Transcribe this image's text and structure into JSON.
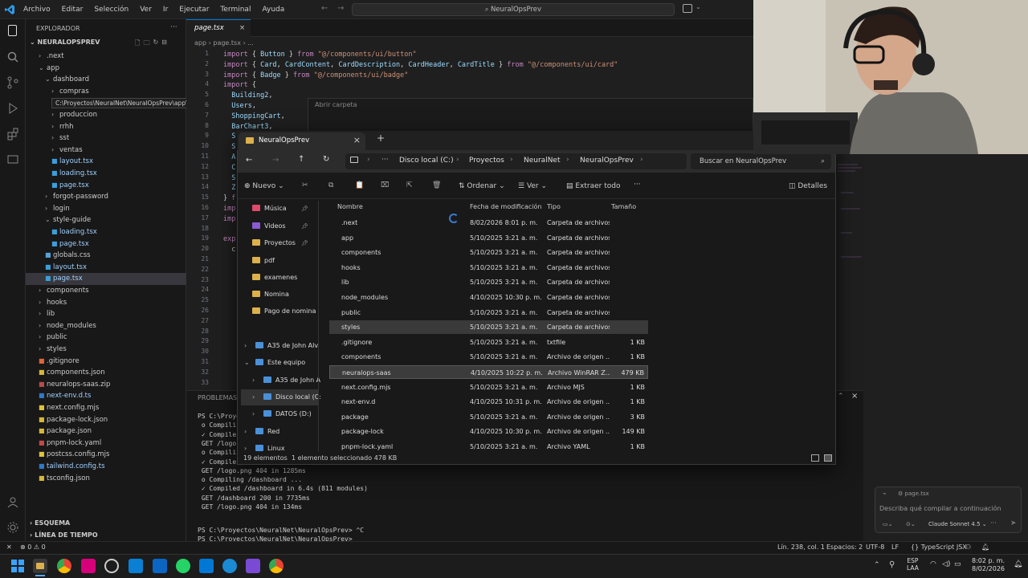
{
  "menu": [
    "Archivo",
    "Editar",
    "Selección",
    "Ver",
    "Ir",
    "Ejecutar",
    "Terminal",
    "Ayuda"
  ],
  "command_center": "NeuralOpsPrev",
  "explorer": {
    "header": "EXPLORADOR",
    "root": "NEURALOPSPREV",
    "tooltip": "C:\\Proyectos\\NeuralNet\\NeuralOpsPrev\\app\\dashboard\\compras",
    "items": [
      {
        "label": ".next",
        "indent": 1,
        "kind": "folder",
        "open": false
      },
      {
        "label": "app",
        "indent": 1,
        "kind": "folder",
        "open": true
      },
      {
        "label": "dashboard",
        "indent": 2,
        "kind": "folder",
        "open": true
      },
      {
        "label": "compras",
        "indent": 3,
        "kind": "folder",
        "open": false
      },
      {
        "label": "",
        "indent": 3,
        "kind": "hidden",
        "open": false
      },
      {
        "label": "produccion",
        "indent": 3,
        "kind": "folder",
        "open": false
      },
      {
        "label": "rrhh",
        "indent": 3,
        "kind": "folder",
        "open": false
      },
      {
        "label": "sst",
        "indent": 3,
        "kind": "folder",
        "open": false
      },
      {
        "label": "ventas",
        "indent": 3,
        "kind": "folder",
        "open": false
      },
      {
        "label": "layout.tsx",
        "indent": 3,
        "kind": "tsx",
        "open": false
      },
      {
        "label": "loading.tsx",
        "indent": 3,
        "kind": "tsx",
        "open": false
      },
      {
        "label": "page.tsx",
        "indent": 3,
        "kind": "tsx",
        "open": false
      },
      {
        "label": "forgot-password",
        "indent": 2,
        "kind": "folder",
        "open": false
      },
      {
        "label": "login",
        "indent": 2,
        "kind": "folder",
        "open": false
      },
      {
        "label": "style-guide",
        "indent": 2,
        "kind": "folder",
        "open": true
      },
      {
        "label": "loading.tsx",
        "indent": 3,
        "kind": "tsx",
        "open": false
      },
      {
        "label": "page.tsx",
        "indent": 3,
        "kind": "tsx",
        "open": false
      },
      {
        "label": "globals.css",
        "indent": 2,
        "kind": "css",
        "open": false
      },
      {
        "label": "layout.tsx",
        "indent": 2,
        "kind": "tsx",
        "open": false
      },
      {
        "label": "page.tsx",
        "indent": 2,
        "kind": "tsx",
        "open": false
      },
      {
        "label": "components",
        "indent": 1,
        "kind": "folder",
        "open": false
      },
      {
        "label": "hooks",
        "indent": 1,
        "kind": "folder",
        "open": false
      },
      {
        "label": "lib",
        "indent": 1,
        "kind": "folder",
        "open": false
      },
      {
        "label": "node_modules",
        "indent": 1,
        "kind": "folder",
        "open": false
      },
      {
        "label": "public",
        "indent": 1,
        "kind": "folder",
        "open": false
      },
      {
        "label": "styles",
        "indent": 1,
        "kind": "folder",
        "open": false
      },
      {
        "label": ".gitignore",
        "indent": 1,
        "kind": "git",
        "open": false
      },
      {
        "label": "components.json",
        "indent": 1,
        "kind": "json",
        "open": false
      },
      {
        "label": "neuralops-saas.zip",
        "indent": 1,
        "kind": "zip",
        "open": false
      },
      {
        "label": "next-env.d.ts",
        "indent": 1,
        "kind": "ts",
        "open": false
      },
      {
        "label": "next.config.mjs",
        "indent": 1,
        "kind": "js",
        "open": false
      },
      {
        "label": "package-lock.json",
        "indent": 1,
        "kind": "json",
        "open": false
      },
      {
        "label": "package.json",
        "indent": 1,
        "kind": "json",
        "open": false
      },
      {
        "label": "pnpm-lock.yaml",
        "indent": 1,
        "kind": "yaml",
        "open": false
      },
      {
        "label": "postcss.config.mjs",
        "indent": 1,
        "kind": "js",
        "open": false
      },
      {
        "label": "tailwind.config.ts",
        "indent": 1,
        "kind": "ts",
        "open": false
      },
      {
        "label": "tsconfig.json",
        "indent": 1,
        "kind": "json",
        "open": false
      }
    ],
    "outline": "ESQUEMA",
    "timeline": "LÍNEA DE TIEMPO"
  },
  "editor": {
    "tab": "page.tsx",
    "breadcrumb": [
      "app",
      "page.tsx",
      "..."
    ],
    "lines": [
      {
        "n": "1",
        "t": [
          [
            "kw",
            "import "
          ],
          [
            "pl",
            "{ "
          ],
          [
            "id",
            "Button"
          ],
          [
            "pl",
            " } "
          ],
          [
            "kw",
            "from "
          ],
          [
            "str",
            "\"@/components/ui/button\""
          ]
        ]
      },
      {
        "n": "2",
        "t": [
          [
            "kw",
            "import "
          ],
          [
            "pl",
            "{ "
          ],
          [
            "id",
            "Card"
          ],
          [
            "pl",
            ", "
          ],
          [
            "id",
            "CardContent"
          ],
          [
            "pl",
            ", "
          ],
          [
            "id",
            "CardDescription"
          ],
          [
            "pl",
            ", "
          ],
          [
            "id",
            "CardHeader"
          ],
          [
            "pl",
            ", "
          ],
          [
            "id",
            "CardTitle"
          ],
          [
            "pl",
            " } "
          ],
          [
            "kw",
            "from "
          ],
          [
            "str",
            "\"@/components/ui/card\""
          ]
        ]
      },
      {
        "n": "3",
        "t": [
          [
            "kw",
            "import "
          ],
          [
            "pl",
            "{ "
          ],
          [
            "id",
            "Badge"
          ],
          [
            "pl",
            " } "
          ],
          [
            "kw",
            "from "
          ],
          [
            "str",
            "\"@/components/ui/badge\""
          ]
        ]
      },
      {
        "n": "4",
        "t": [
          [
            "kw",
            "import "
          ],
          [
            "pl",
            "{"
          ]
        ]
      },
      {
        "n": "5",
        "t": [
          [
            "pl",
            "  "
          ],
          [
            "id",
            "Building2"
          ],
          [
            "pl",
            ","
          ]
        ]
      },
      {
        "n": "6",
        "t": [
          [
            "pl",
            "  "
          ],
          [
            "id",
            "Users"
          ],
          [
            "pl",
            ","
          ]
        ]
      },
      {
        "n": "7",
        "t": [
          [
            "pl",
            "  "
          ],
          [
            "id",
            "ShoppingCart"
          ],
          [
            "pl",
            ","
          ]
        ]
      },
      {
        "n": "8",
        "t": [
          [
            "pl",
            "  "
          ],
          [
            "id",
            "BarChart3"
          ],
          [
            "pl",
            ","
          ]
        ]
      },
      {
        "n": "9",
        "t": [
          [
            "pl",
            "  "
          ],
          [
            "id",
            "S"
          ]
        ]
      },
      {
        "n": "10",
        "t": [
          [
            "pl",
            "  "
          ],
          [
            "id",
            "S"
          ]
        ]
      },
      {
        "n": "11",
        "t": [
          [
            "pl",
            "  "
          ],
          [
            "id",
            "A"
          ]
        ]
      },
      {
        "n": "12",
        "t": [
          [
            "pl",
            "  "
          ],
          [
            "id",
            "C"
          ]
        ]
      },
      {
        "n": "13",
        "t": [
          [
            "pl",
            "  "
          ],
          [
            "id",
            "S"
          ]
        ]
      },
      {
        "n": "14",
        "t": [
          [
            "pl",
            "  "
          ],
          [
            "id",
            "Z"
          ]
        ]
      },
      {
        "n": "15",
        "t": [
          [
            "pl",
            "} "
          ],
          [
            "kw",
            "f"
          ]
        ]
      },
      {
        "n": "16",
        "t": [
          [
            "kw",
            "imp"
          ]
        ]
      },
      {
        "n": "17",
        "t": [
          [
            "kw",
            "imp"
          ]
        ]
      },
      {
        "n": "18",
        "t": [
          [
            "pl",
            ""
          ]
        ]
      },
      {
        "n": "19",
        "t": [
          [
            "kw",
            "exp"
          ]
        ]
      },
      {
        "n": "20",
        "t": [
          [
            "pl",
            "  c"
          ]
        ]
      },
      {
        "n": "21",
        "t": [
          [
            "pl",
            ""
          ]
        ]
      },
      {
        "n": "22",
        "t": [
          [
            "pl",
            ""
          ]
        ]
      },
      {
        "n": "23",
        "t": [
          [
            "pl",
            ""
          ]
        ]
      },
      {
        "n": "24",
        "t": [
          [
            "pl",
            ""
          ]
        ]
      },
      {
        "n": "25",
        "t": [
          [
            "pl",
            ""
          ]
        ]
      },
      {
        "n": "26",
        "t": [
          [
            "pl",
            ""
          ]
        ]
      },
      {
        "n": "27",
        "t": [
          [
            "pl",
            ""
          ]
        ]
      },
      {
        "n": "28",
        "t": [
          [
            "pl",
            ""
          ]
        ]
      },
      {
        "n": "29",
        "t": [
          [
            "pl",
            ""
          ]
        ]
      },
      {
        "n": "30",
        "t": [
          [
            "pl",
            ""
          ]
        ]
      },
      {
        "n": "31",
        "t": [
          [
            "pl",
            ""
          ]
        ]
      },
      {
        "n": "32",
        "t": [
          [
            "pl",
            ""
          ]
        ]
      },
      {
        "n": "33",
        "t": [
          [
            "pl",
            ""
          ]
        ]
      }
    ],
    "dialog_hint": "Abrir carpeta"
  },
  "terminal": {
    "tab": "PROBLEMAS",
    "lines": [
      "PS C:\\Proyec",
      " o Compili",
      " ✓ Compile",
      " GET /logo",
      " o Compili",
      " ✓ Compile",
      " GET /logo.png 404 in 1285ms",
      " o Compiling /dashboard ...",
      " ✓ Compiled /dashboard in 6.4s (811 modules)",
      " GET /dashboard 200 in 7735ms",
      " GET /logo.png 404 in 134ms",
      "",
      "PS C:\\Proyectos\\NeuralNet\\NeuralOpsPrev> ^C",
      "PS C:\\Proyectos\\NeuralNet\\NeuralOpsPrev> "
    ]
  },
  "status": {
    "errors": "⊗ 0  ⚠ 0",
    "position": "Lín. 238, col. 1",
    "spaces": "Espacios: 2",
    "encoding": "UTF-8",
    "eol": "LF",
    "language": "{} TypeScript JSX"
  },
  "chat": {
    "file": "page.tsx",
    "placeholder": "Describa qué compilar a continuación",
    "model": "Claude Sonnet 4.5"
  },
  "explorer_window": {
    "tab_title": "NeuralOpsPrev",
    "breadcrumb": [
      "Disco local (C:)",
      "Proyectos",
      "NeuralNet",
      "NeuralOpsPrev"
    ],
    "search_placeholder": "Buscar en NeuralOpsPrev",
    "toolbar": {
      "new": "Nuevo",
      "sort": "Ordenar",
      "view": "Ver",
      "extract": "Extraer todo",
      "details": "Detalles"
    },
    "nav": [
      {
        "label": "Música",
        "pin": true
      },
      {
        "label": "Videos",
        "pin": true
      },
      {
        "label": "Proyectos",
        "pin": true
      },
      {
        "label": "pdf",
        "pin": false
      },
      {
        "label": "examenes",
        "pin": false
      },
      {
        "label": "Nomina",
        "pin": false
      },
      {
        "label": "Pago de nomina",
        "pin": false
      },
      {
        "label": "",
        "pin": false
      },
      {
        "label": "A35 de John Alv",
        "pin": false
      },
      {
        "label": "Este equipo",
        "pin": false
      },
      {
        "label": "A35 de John A",
        "pin": false
      },
      {
        "label": "Disco local (C:",
        "pin": false
      },
      {
        "label": "DATOS (D:)",
        "pin": false
      },
      {
        "label": "Red",
        "pin": false
      },
      {
        "label": "Linux",
        "pin": false
      }
    ],
    "columns": [
      "Nombre",
      "Fecha de modificación",
      "Tipo",
      "Tamaño"
    ],
    "files": [
      {
        "name": ".next",
        "date": "8/02/2026 8:01 p. m.",
        "type": "Carpeta de archivos",
        "size": "",
        "kind": "folder"
      },
      {
        "name": "app",
        "date": "5/10/2025 3:21 a. m.",
        "type": "Carpeta de archivos",
        "size": "",
        "kind": "folder"
      },
      {
        "name": "components",
        "date": "5/10/2025 3:21 a. m.",
        "type": "Carpeta de archivos",
        "size": "",
        "kind": "folder"
      },
      {
        "name": "hooks",
        "date": "5/10/2025 3:21 a. m.",
        "type": "Carpeta de archivos",
        "size": "",
        "kind": "folder"
      },
      {
        "name": "lib",
        "date": "5/10/2025 3:21 a. m.",
        "type": "Carpeta de archivos",
        "size": "",
        "kind": "folder"
      },
      {
        "name": "node_modules",
        "date": "4/10/2025 10:30 p. m.",
        "type": "Carpeta de archivos",
        "size": "",
        "kind": "folder"
      },
      {
        "name": "public",
        "date": "5/10/2025 3:21 a. m.",
        "type": "Carpeta de archivos",
        "size": "",
        "kind": "folder"
      },
      {
        "name": "styles",
        "date": "5/10/2025 3:21 a. m.",
        "type": "Carpeta de archivos",
        "size": "",
        "kind": "folder"
      },
      {
        "name": ".gitignore",
        "date": "5/10/2025 3:21 a. m.",
        "type": "txtfile",
        "size": "1 KB",
        "kind": "file"
      },
      {
        "name": "components",
        "date": "5/10/2025 3:21 a. m.",
        "type": "Archivo de origen ...",
        "size": "1 KB",
        "kind": "file"
      },
      {
        "name": "neuralops-saas",
        "date": "4/10/2025 10:22 p. m.",
        "type": "Archivo WinRAR Z...",
        "size": "479 KB",
        "kind": "zip"
      },
      {
        "name": "next.config.mjs",
        "date": "5/10/2025 3:21 a. m.",
        "type": "Archivo MJS",
        "size": "1 KB",
        "kind": "file"
      },
      {
        "name": "next-env.d",
        "date": "4/10/2025 10:31 p. m.",
        "type": "Archivo de origen ...",
        "size": "1 KB",
        "kind": "file"
      },
      {
        "name": "package",
        "date": "5/10/2025 3:21 a. m.",
        "type": "Archivo de origen ...",
        "size": "3 KB",
        "kind": "file"
      },
      {
        "name": "package-lock",
        "date": "4/10/2025 10:30 p. m.",
        "type": "Archivo de origen ...",
        "size": "149 KB",
        "kind": "file"
      },
      {
        "name": "pnpm-lock.yaml",
        "date": "5/10/2025 3:21 a. m.",
        "type": "Archivo YAML",
        "size": "1 KB",
        "kind": "file"
      }
    ],
    "status_count": "19 elementos",
    "status_selected": "1 elemento seleccionado  478 KB"
  },
  "tray": {
    "lang": "ESP",
    "layout": "LAA",
    "time": "8:02 p. m.",
    "date": "8/02/2026"
  }
}
